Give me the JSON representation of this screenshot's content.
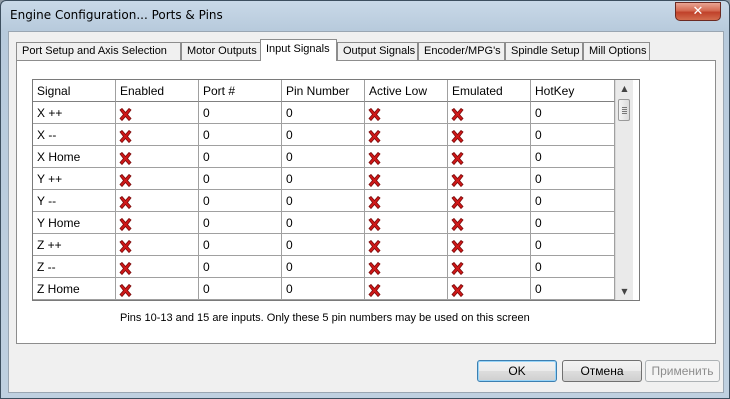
{
  "window": {
    "title": "Engine Configuration... Ports & Pins",
    "close_glyph": "✕"
  },
  "tabs": [
    {
      "label": "Port Setup and Axis Selection",
      "active": false
    },
    {
      "label": "Motor Outputs",
      "active": false
    },
    {
      "label": "Input Signals",
      "active": true
    },
    {
      "label": "Output Signals",
      "active": false
    },
    {
      "label": "Encoder/MPG's",
      "active": false
    },
    {
      "label": "Spindle Setup",
      "active": false
    },
    {
      "label": "Mill Options",
      "active": false
    }
  ],
  "grid": {
    "columns": [
      "Signal",
      "Enabled",
      "Port #",
      "Pin Number",
      "Active Low",
      "Emulated",
      "HotKey"
    ],
    "rows": [
      {
        "signal": "X ++",
        "enabled": "red-x-icon",
        "port": "0",
        "pin": "0",
        "active_low": "red-x-icon",
        "emulated": "red-x-icon",
        "hotkey": "0"
      },
      {
        "signal": "X --",
        "enabled": "red-x-icon",
        "port": "0",
        "pin": "0",
        "active_low": "red-x-icon",
        "emulated": "red-x-icon",
        "hotkey": "0"
      },
      {
        "signal": "X Home",
        "enabled": "red-x-icon",
        "port": "0",
        "pin": "0",
        "active_low": "red-x-icon",
        "emulated": "red-x-icon",
        "hotkey": "0"
      },
      {
        "signal": "Y ++",
        "enabled": "red-x-icon",
        "port": "0",
        "pin": "0",
        "active_low": "red-x-icon",
        "emulated": "red-x-icon",
        "hotkey": "0"
      },
      {
        "signal": "Y --",
        "enabled": "red-x-icon",
        "port": "0",
        "pin": "0",
        "active_low": "red-x-icon",
        "emulated": "red-x-icon",
        "hotkey": "0"
      },
      {
        "signal": "Y Home",
        "enabled": "red-x-icon",
        "port": "0",
        "pin": "0",
        "active_low": "red-x-icon",
        "emulated": "red-x-icon",
        "hotkey": "0"
      },
      {
        "signal": "Z ++",
        "enabled": "red-x-icon",
        "port": "0",
        "pin": "0",
        "active_low": "red-x-icon",
        "emulated": "red-x-icon",
        "hotkey": "0"
      },
      {
        "signal": "Z --",
        "enabled": "red-x-icon",
        "port": "0",
        "pin": "0",
        "active_low": "red-x-icon",
        "emulated": "red-x-icon",
        "hotkey": "0"
      },
      {
        "signal": "Z Home",
        "enabled": "red-x-icon",
        "port": "0",
        "pin": "0",
        "active_low": "red-x-icon",
        "emulated": "red-x-icon",
        "hotkey": "0"
      }
    ]
  },
  "note": "Pins 10-13 and 15 are inputs. Only these 5 pin numbers may be used on this screen",
  "buttons": {
    "ok": "OK",
    "cancel": "Отмена",
    "apply": "Применить"
  },
  "colors": {
    "x_icon": "#d01818",
    "x_icon_dark": "#7a0a0a"
  }
}
